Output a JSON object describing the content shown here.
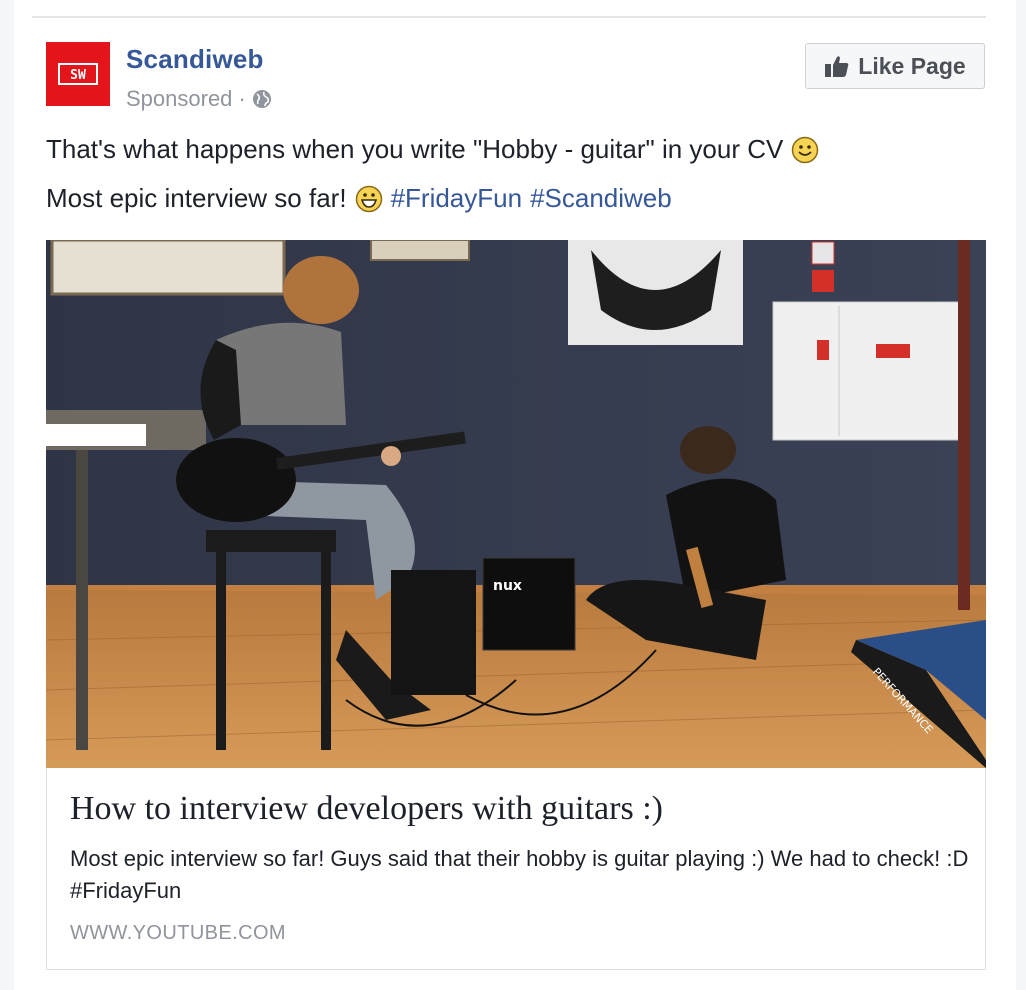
{
  "post": {
    "page_name": "Scandiweb",
    "logo_text": "SW",
    "sponsored_label": "Sponsored",
    "separator": "·",
    "like_button_label": "Like Page",
    "message": {
      "line1_text": "That's what happens when you write \"Hobby - guitar\" in your CV",
      "line2_text": "Most epic interview so far!",
      "hashtags": [
        "#FridayFun",
        "#Scandiweb"
      ]
    }
  },
  "attachment": {
    "title": "How to interview developers with guitars :)",
    "description": "Most epic interview so far! Guys said that their hobby is guitar playing :) We had to check! :D #FridayFun",
    "domain": "WWW.YOUTUBE.COM",
    "image_texts": {
      "amp_brand": "nux",
      "table_text": "PERFORMANCE"
    }
  },
  "colors": {
    "brand_red": "#e3151a",
    "link_blue": "#365899",
    "meta_gray": "#90949c"
  }
}
